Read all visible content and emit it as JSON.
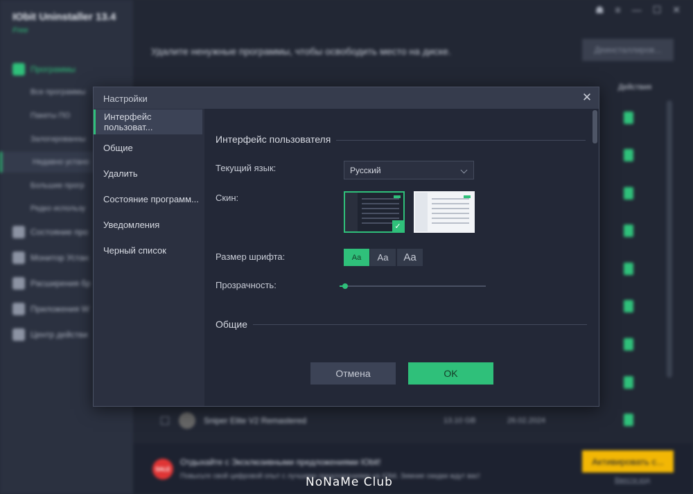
{
  "app": {
    "title": "IObit Uninstaller 13.4",
    "edition": "Free",
    "window_controls": [
      "☗",
      "≡",
      "—",
      "☐",
      "✕"
    ]
  },
  "sidebar": {
    "main_items": [
      {
        "label": "Программы",
        "icon": "grid-icon",
        "active": true
      },
      {
        "label": "Состояние про",
        "icon": "plus-square-icon"
      },
      {
        "label": "Монитор Устан",
        "icon": "chart-icon"
      },
      {
        "label": "Расширения бр",
        "icon": "puzzle-icon"
      },
      {
        "label": "Приложения W",
        "icon": "windows-icon"
      },
      {
        "label": "Центр действи",
        "icon": "flag-icon"
      }
    ],
    "sub_items": [
      {
        "label": "Все программы"
      },
      {
        "label": "Пакеты ПО"
      },
      {
        "label": "Залогированны"
      },
      {
        "label": "Недавно устано",
        "active": true
      },
      {
        "label": "Большие прогр"
      },
      {
        "label": "Редко использу"
      }
    ]
  },
  "main": {
    "headline": "Удалите ненужные программы, чтобы освободить место на диске.",
    "deinstall_label": "Деинсталлиров...",
    "col_action": "Действия",
    "row": {
      "name": "Sniper Elite V2 Remastered",
      "size": "13.10 GB",
      "date": "26.02.2024"
    }
  },
  "promo": {
    "badge": "SALE",
    "line1": "Отдыхайте с Эксклюзивными предложениями IObit!",
    "line2": "Повысьте свой цифровой опыт с лучшими предложениями на IObit. Зимние скидки ждут вас!",
    "activate_label": "Активировать с...",
    "enter_code": "Ввести код"
  },
  "watermark": "NoNaMe Club",
  "dialog": {
    "title": "Настройки",
    "close": "✕",
    "nav": [
      {
        "label": "Интерфейс пользоват...",
        "active": true
      },
      {
        "label": "Общие"
      },
      {
        "label": "Удалить"
      },
      {
        "label": "Состояние программ..."
      },
      {
        "label": "Уведомления"
      },
      {
        "label": "Черный список"
      }
    ],
    "section_ui": "Интерфейс пользователя",
    "lang_label": "Текущий язык:",
    "lang_value": "Русский",
    "skin_label": "Скин:",
    "skin_selected": "dark",
    "font_label": "Размер шрифта:",
    "font_options": [
      "Aa",
      "Aa",
      "Aa"
    ],
    "font_selected": 0,
    "transparency_label": "Прозрачность:",
    "transparency_value": 0.04,
    "section_general": "Общие",
    "cancel_label": "Отмена",
    "ok_label": "OK"
  },
  "colors": {
    "accent": "#2fc07a",
    "dialog_bg": "#232837",
    "nav_bg": "#2b3040",
    "promo_button": "#f2b705"
  }
}
